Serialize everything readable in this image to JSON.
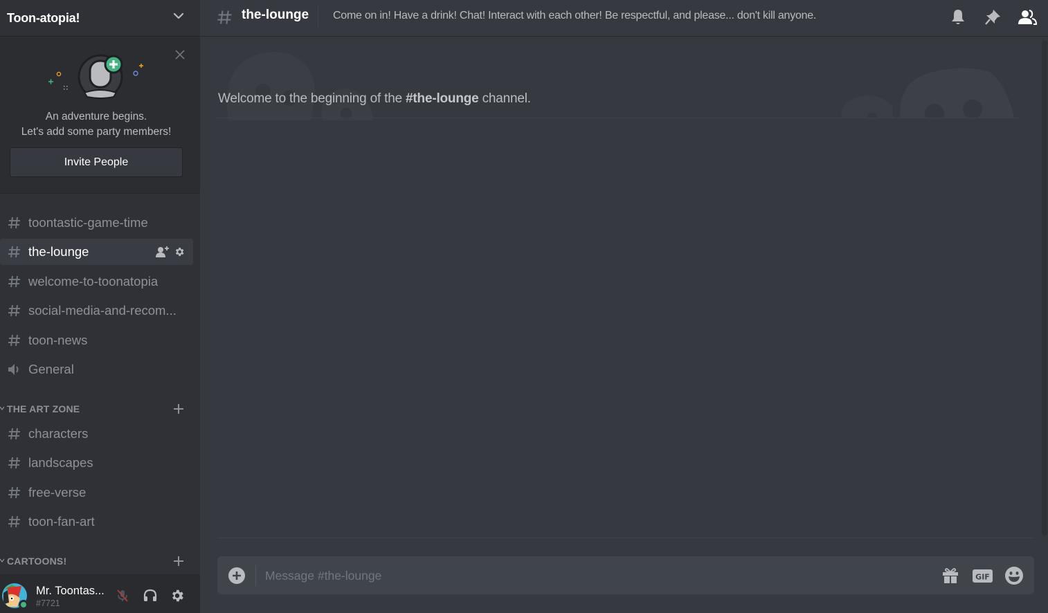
{
  "server": {
    "name": "Toon-atopia!"
  },
  "invite": {
    "line1": "An adventure begins.",
    "line2": "Let's add some party members!",
    "button_label": "Invite People"
  },
  "channels": [
    {
      "name": "toontastic-game-time",
      "type": "text",
      "active": false
    },
    {
      "name": "the-lounge",
      "type": "text",
      "active": true
    },
    {
      "name": "welcome-to-toonatopia",
      "type": "text",
      "active": false
    },
    {
      "name": "social-media-and-recom...",
      "type": "text",
      "active": false
    },
    {
      "name": "toon-news",
      "type": "text",
      "active": false
    },
    {
      "name": "General",
      "type": "voice",
      "active": false
    }
  ],
  "categories": [
    {
      "name": "THE ART ZONE",
      "channels": [
        {
          "name": "characters",
          "type": "text"
        },
        {
          "name": "landscapes",
          "type": "text"
        },
        {
          "name": "free-verse",
          "type": "text"
        },
        {
          "name": "toon-fan-art",
          "type": "text"
        }
      ]
    },
    {
      "name": "CARTOONS!",
      "channels": []
    }
  ],
  "user": {
    "name": "Mr. Toontas...",
    "discriminator": "#7721",
    "status": "online",
    "status_color": "#43b581"
  },
  "header": {
    "channel_name": "the-lounge",
    "topic": "Come on in! Have a drink! Chat! Interact with each other! Be respectful, and please... don't kill anyone.",
    "icons": [
      "bell-icon",
      "pin-icon",
      "members-icon"
    ]
  },
  "welcome": {
    "prefix": "Welcome to the beginning of the ",
    "channel": "#the-lounge",
    "suffix": " channel."
  },
  "composer": {
    "placeholder": "Message #the-lounge",
    "value": ""
  },
  "colors": {
    "accent_green": "#43b581",
    "sidebar_bg": "#2f3136",
    "chat_bg": "#36393f"
  }
}
